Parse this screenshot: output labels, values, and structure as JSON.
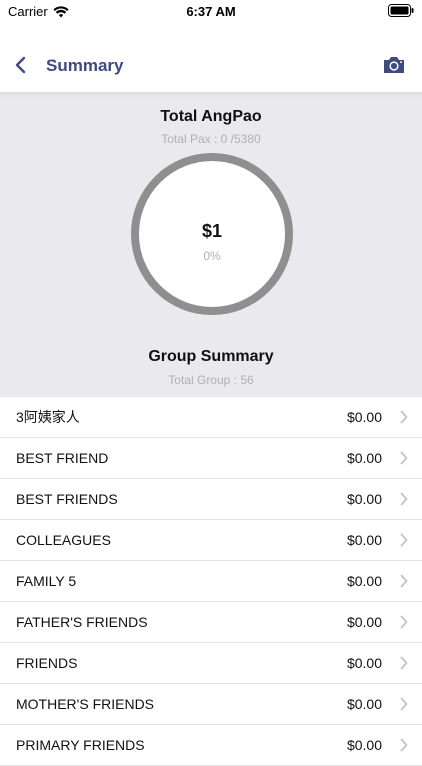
{
  "status_bar": {
    "carrier": "Carrier",
    "time": "6:37 AM"
  },
  "nav": {
    "title": "Summary",
    "back_icon": "chevron-left-icon",
    "camera_icon": "camera-icon"
  },
  "summary": {
    "title": "Total AngPao",
    "pax_text": "Total Pax : 0 /5380",
    "amount": "$1",
    "percent": "0%",
    "group_title": "Group Summary",
    "group_count_text": "Total Group : 56"
  },
  "groups": [
    {
      "name": "3阿姨家人",
      "amount": "$0.00"
    },
    {
      "name": "BEST FRIEND",
      "amount": "$0.00"
    },
    {
      "name": "BEST FRIENDS",
      "amount": "$0.00"
    },
    {
      "name": "COLLEAGUES",
      "amount": "$0.00"
    },
    {
      "name": "FAMILY 5",
      "amount": "$0.00"
    },
    {
      "name": "FATHER'S FRIENDS",
      "amount": "$0.00"
    },
    {
      "name": "FRIENDS",
      "amount": "$0.00"
    },
    {
      "name": "MOTHER'S FRIENDS",
      "amount": "$0.00"
    },
    {
      "name": "PRIMARY FRIENDS",
      "amount": "$0.00"
    }
  ],
  "colors": {
    "accent": "#3f4a80",
    "panel_bg": "#e9e9ee",
    "ring": "#8f8f8f"
  }
}
